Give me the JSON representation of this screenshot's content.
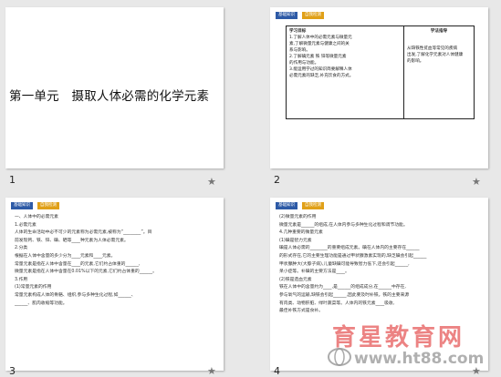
{
  "slides": [
    {
      "number": "1",
      "title": "第一单元　摄取人体必需的化学元素"
    },
    {
      "number": "2",
      "tags": [
        "基础知识",
        "自我检测"
      ],
      "table_left_head": "学习目标",
      "table_left": [
        "1.了解人体中的必需元素与微量元",
        "素,了解微量元素与健康之间的关",
        "系与影响。",
        "2.了解碘元素    铁    锌等微量元素",
        "的作用与功能。",
        "3.能运用学过的知识简要解释人体",
        "必需元素的缺乏,补充饮食的方式。"
      ],
      "table_right_head": "学法指导",
      "table_right": [
        "从缺铁性贫血等常见的疾病",
        "出发,了解化学元素对人体健康",
        "的影响。"
      ]
    },
    {
      "number": "3",
      "tags": [
        "基础知识",
        "自我检测"
      ],
      "lines": [
        "一、人体中的必需元素",
        "1.必需元素",
        "人体的生命活动中必不可少的元素称为必需元素,被称为“________”。目",
        "前发现钙、铁、锌、碘、硒等____种元素为人体必需元素。",
        "2.分类",
        "根据在人体中含量的多少分为____元素和____元素。",
        "常量元素是指在人体中含量在____的元素,它们约占体重的______,",
        "微量元素是指在人体中含量在0.01%以下的元素,它们约占体重的______。",
        "3.作用",
        "(1)常量元素的作用",
        "常量元素构成人体的骨骼、组织,参与多种生化过程,如______、",
        "______、肌肉收缩等功能。"
      ]
    },
    {
      "number": "4",
      "tags": [
        "基础知识",
        "自我检测"
      ],
      "lines": [
        "(2)微量元素的作用",
        "微量元素是______的组成,在人体内参与多种生化过程和调节功能。",
        "4.几种重要的微量元素",
        "(1)碘是智力元素",
        "碘是人体必需的________的重要组成元素。碘在人体内的主要存在______",
        "的形式存在,它的主要生理功能是通过甲状腺激素实现的,缺乏碘会引起______",
        "甲状腺肿大(大脖子病),儿童缺碘可能导致智力低下,还会引起______,",
        "呆小症等。补碘的主要方法是____。",
        "(2)铁是造血元素",
        "铁在人体中的含量约为____,是______的组成成分,在______中存在,",
        "参与氧气的运输,缺铁会引起______,因此要及时补铁。铁的主要来源",
        "有肉类、动物肝脏、绿叶蔬菜等。人体内的铁元素____吸收,",
        "最佳补铁方式是食补。"
      ]
    }
  ],
  "watermark": {
    "text": "育星教育网",
    "url": "www.ht88.com"
  }
}
